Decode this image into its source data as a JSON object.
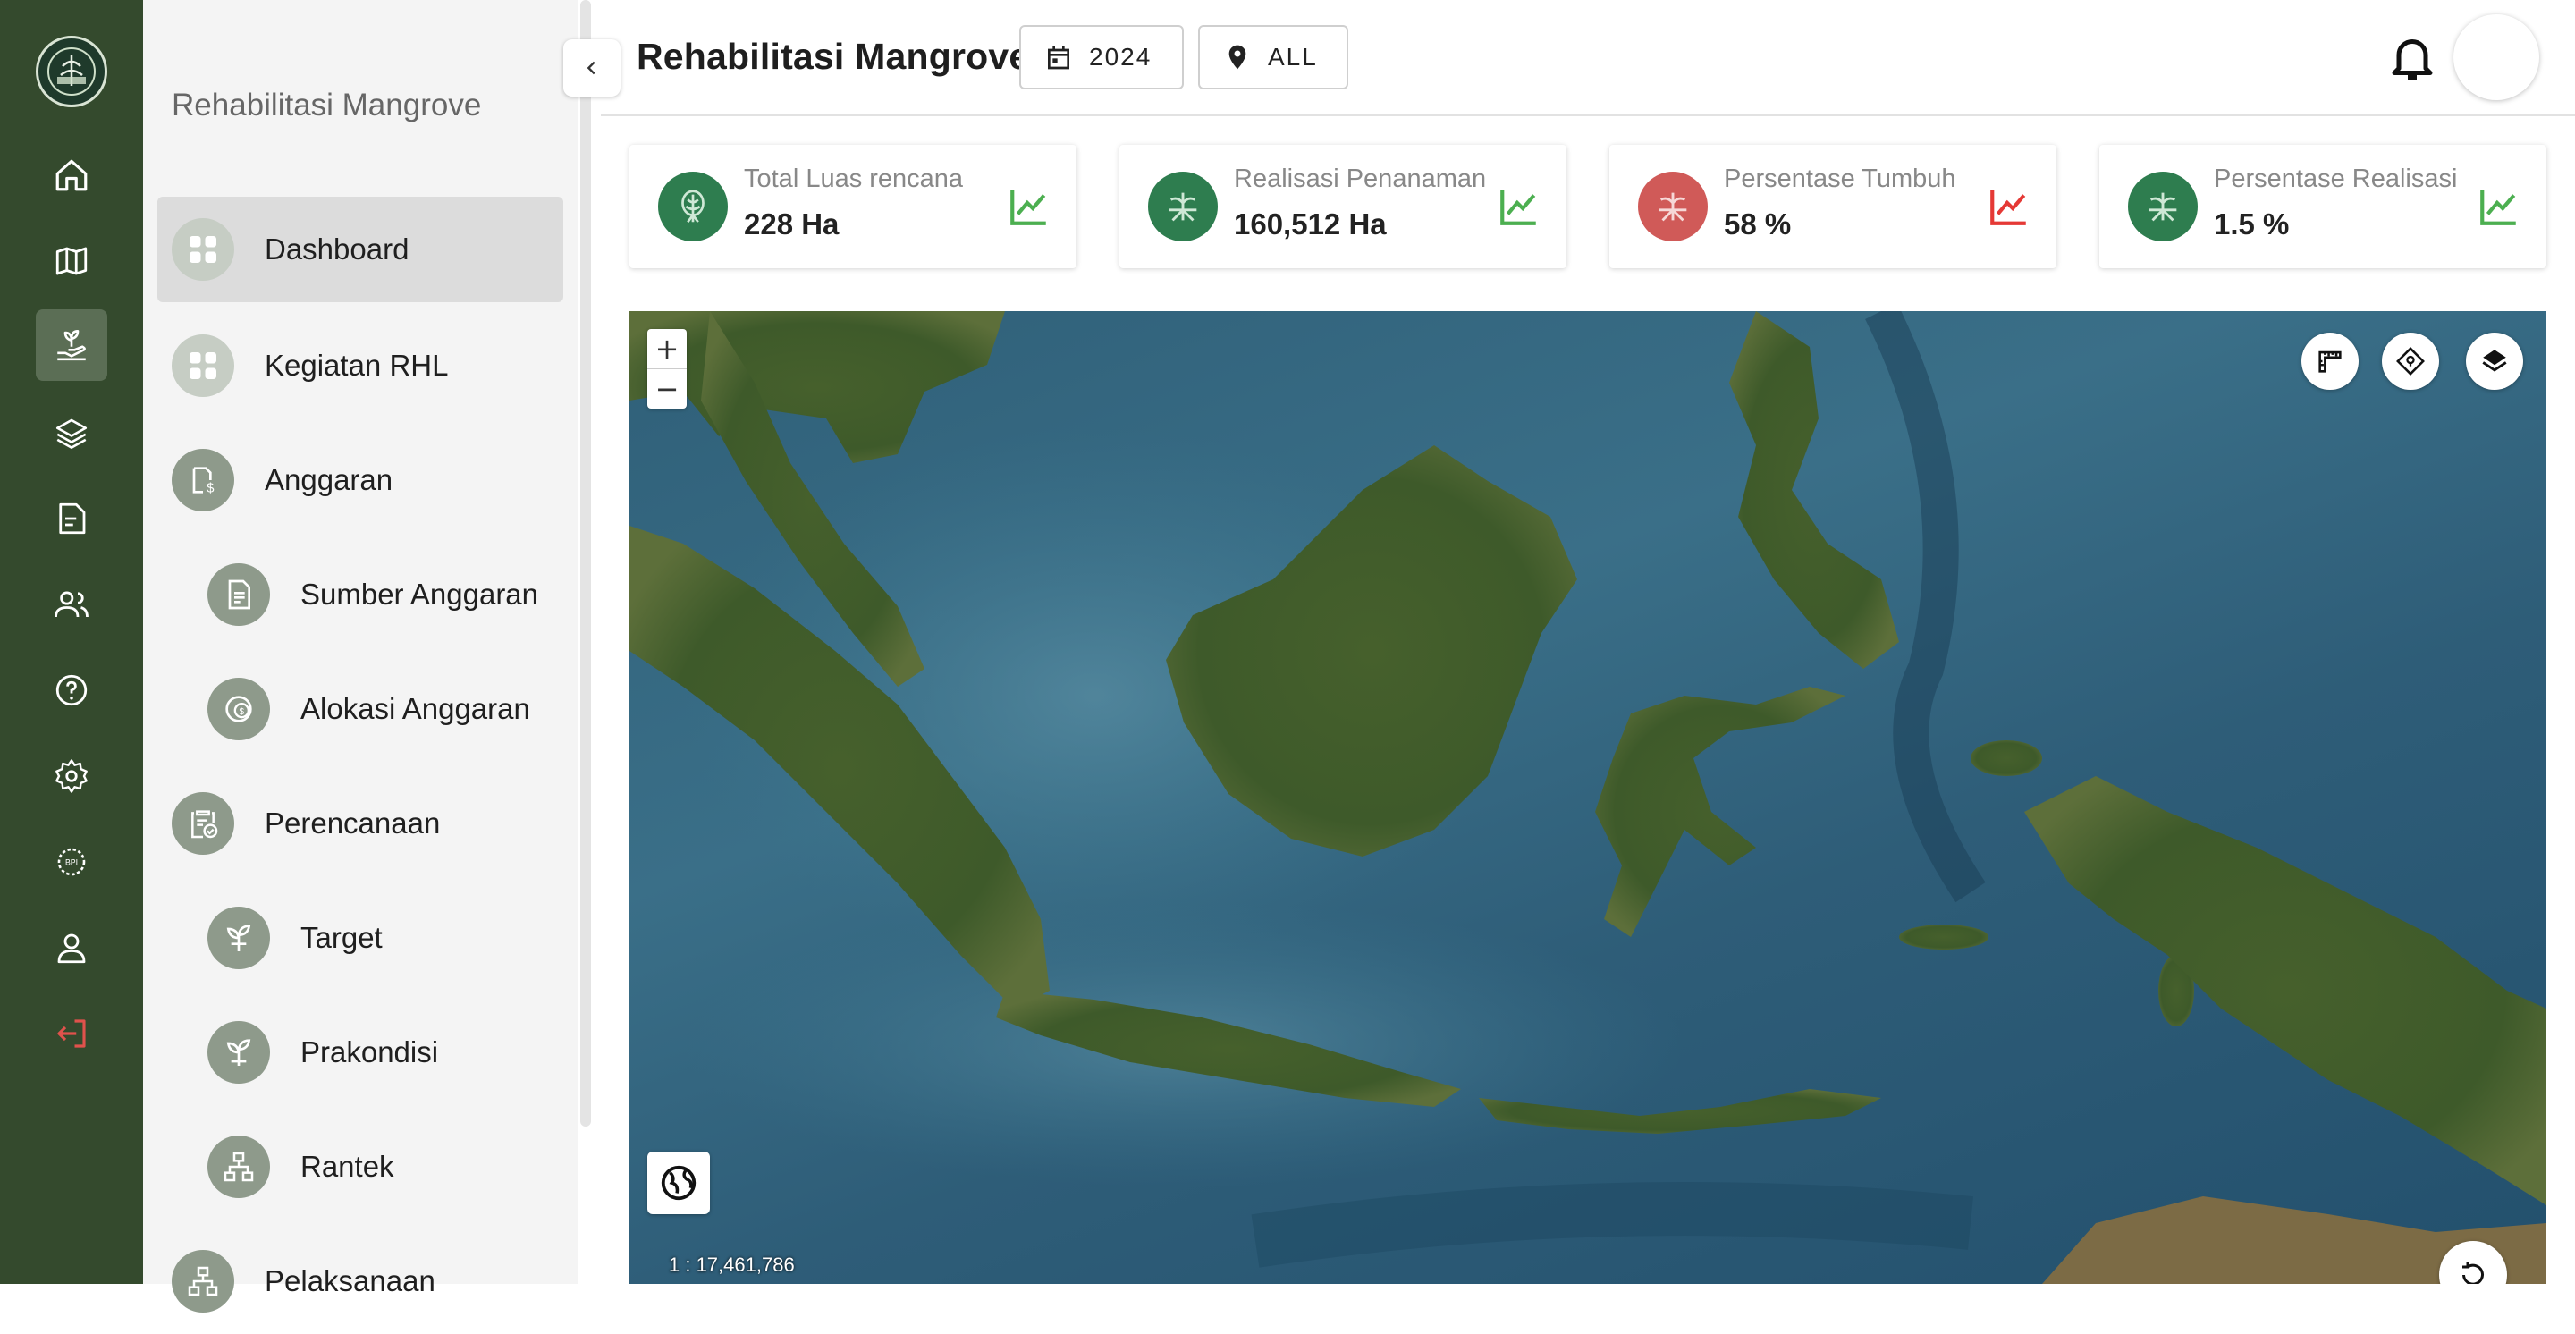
{
  "header": {
    "title": "Rehabilitasi Mangrove",
    "year": "2024",
    "region": "ALL"
  },
  "sidebar": {
    "title": "Rehabilitasi Mangrove",
    "items": [
      {
        "label": "Dashboard",
        "icon": "grid-icon",
        "active": true
      },
      {
        "label": "Kegiatan RHL",
        "icon": "grid-icon"
      },
      {
        "label": "Anggaran",
        "icon": "budget-icon"
      },
      {
        "label": "Sumber Anggaran",
        "icon": "document-icon"
      },
      {
        "label": "Alokasi Anggaran",
        "icon": "coin-icon"
      },
      {
        "label": "Perencanaan",
        "icon": "clipboard-check-icon"
      },
      {
        "label": "Target",
        "icon": "sprout-icon"
      },
      {
        "label": "Prakondisi",
        "icon": "sprout-icon"
      },
      {
        "label": "Rantek",
        "icon": "hierarchy-icon"
      },
      {
        "label": "Pelaksanaan",
        "icon": "hierarchy-icon"
      }
    ]
  },
  "rail": {
    "items": [
      "home-icon",
      "map-icon",
      "plant-hand-icon",
      "layers-icon",
      "report-icon",
      "users-icon",
      "help-icon",
      "settings-icon",
      "bpi-badge-icon",
      "user-icon",
      "logout-icon"
    ]
  },
  "cards": [
    {
      "label": "Total Luas rencana",
      "value": "228 Ha",
      "icon": "mangrove-icon",
      "icon_color": "#2e7d4f",
      "trend_color": "#4caf50"
    },
    {
      "label": "Realisasi Penanaman",
      "value": "160,512 Ha",
      "icon": "mangrove-roots-icon",
      "icon_color": "#2e7d4f",
      "trend_color": "#4caf50"
    },
    {
      "label": "Persentase Tumbuh",
      "value": "58 %",
      "icon": "mangrove-roots-icon",
      "icon_color": "#d05a58",
      "trend_color": "#e53935"
    },
    {
      "label": "Persentase Realisasi",
      "value": "1.5 %",
      "icon": "mangrove-roots-icon",
      "icon_color": "#2e7d4f",
      "trend_color": "#4caf50"
    }
  ],
  "map": {
    "zoom_in": "+",
    "zoom_out": "−",
    "scale": "1 : 17,461,786",
    "controls": [
      "measure-ruler-icon",
      "locate-icon",
      "layers-icon"
    ]
  },
  "colors": {
    "rail_bg": "#344a2d",
    "accent_green": "#2e7d4f",
    "accent_red": "#d05a58"
  }
}
